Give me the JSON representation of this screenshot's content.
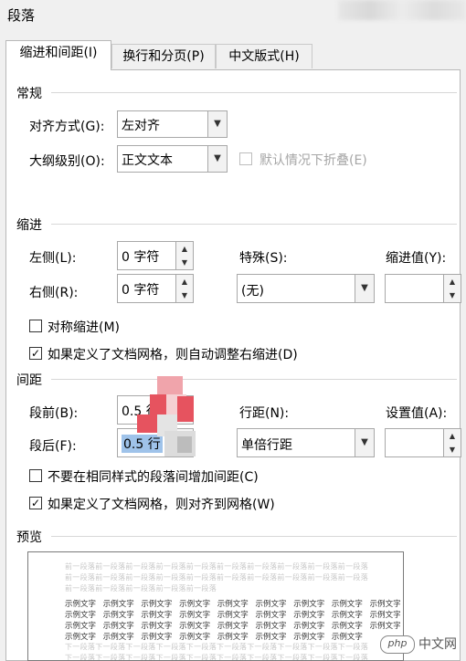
{
  "dialog": {
    "title": "段落"
  },
  "tabs": [
    {
      "label": "缩进和间距(I)"
    },
    {
      "label": "换行和分页(P)"
    },
    {
      "label": "中文版式(H)"
    }
  ],
  "general": {
    "section": "常规",
    "alignment_label": "对齐方式(G):",
    "alignment_value": "左对齐",
    "outline_label": "大纲级别(O):",
    "outline_value": "正文文本",
    "collapse_label": "默认情况下折叠(E)"
  },
  "indent": {
    "section": "缩进",
    "left_label": "左侧(L):",
    "left_value": "0 字符",
    "right_label": "右侧(R):",
    "right_value": "0 字符",
    "special_label": "特殊(S):",
    "special_value": "(无)",
    "by_label": "缩进值(Y):",
    "mirror_label": "对称缩进(M)",
    "auto_adjust_label": "如果定义了文档网格，则自动调整右缩进(D)"
  },
  "spacing": {
    "section": "间距",
    "before_label": "段前(B):",
    "before_value": "0.5 行",
    "after_label": "段后(F):",
    "after_value": "0.5 行",
    "line_label": "行距(N):",
    "line_value": "单倍行距",
    "at_label": "设置值(A):",
    "no_space_label": "不要在相同样式的段落间增加间距(C)",
    "snap_grid_label": "如果定义了文档网格，则对齐到网格(W)"
  },
  "preview": {
    "section": "预览",
    "prev_line_1": "前一段落前一段落前一段落前一段落前一段落前一段落前一段落前一段落前一段落前一段落",
    "prev_line_2": "前一段落前一段落前一段落前一段落前一段落前一段落前一段落前一段落前一段落前一段落",
    "prev_line_3": "前一段落前一段落前一段落前一段落前一段落",
    "sample_line_1": "示例文字 示例文字 示例文字 示例文字 示例文字 示例文字 示例文字 示例文字 示例文字",
    "sample_line_2": "示例文字 示例文字 示例文字 示例文字 示例文字 示例文字 示例文字 示例文字 示例文字",
    "sample_line_3": "示例文字 示例文字 示例文字 示例文字 示例文字 示例文字 示例文字 示例文字 示例文字",
    "sample_line_4": "示例文字 示例文字 示例文字 示例文字 示例文字 示例文字 示例文字 示例文字",
    "next_line_1": "下一段落下一段落下一段落下一段落下一段落下一段落下一段落下一段落下一段落下一段落",
    "next_line_2": "下一段落下一段落下一段落下一段落下一段落下一段落下一段落下一段落下一段落下一段落"
  },
  "watermark": {
    "logo": "php",
    "text": "中文网"
  },
  "glyphs": {
    "dropdown": "▼",
    "up": "▲",
    "down": "▼",
    "check": "✓"
  },
  "colors": {
    "mosaic_red": "#e6535f",
    "mosaic_pink": "#f0a4ab",
    "selection": "#9fc3ea"
  }
}
